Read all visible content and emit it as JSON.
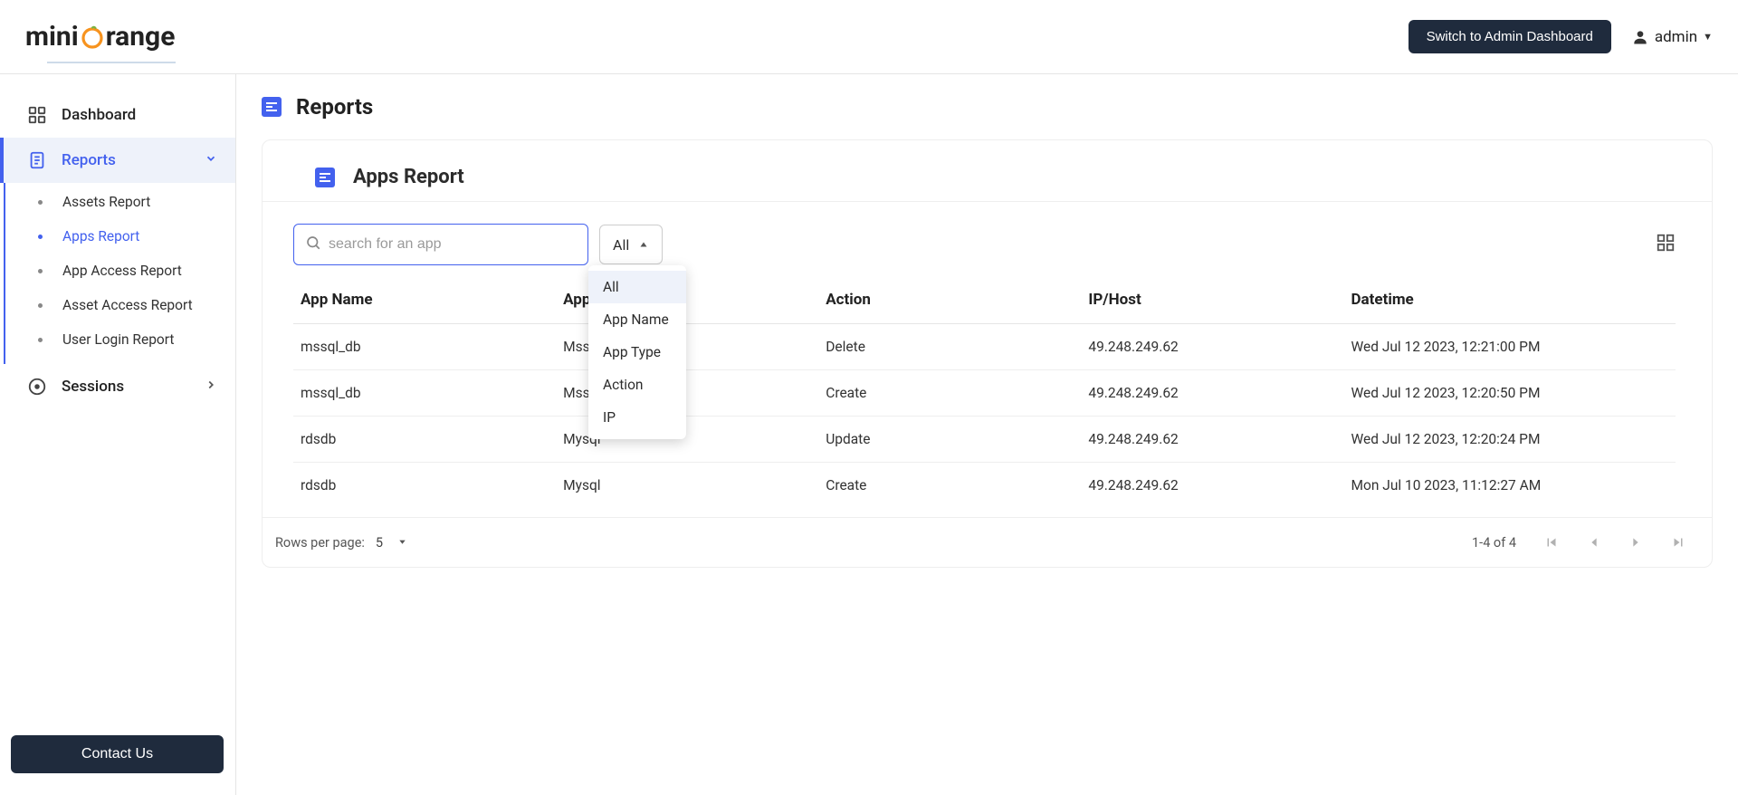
{
  "header": {
    "logo_parts": {
      "pre": "mini",
      "post": "range"
    },
    "switch_btn": "Switch to Admin Dashboard",
    "user_name": "admin"
  },
  "sidebar": {
    "items": [
      {
        "label": "Dashboard"
      },
      {
        "label": "Reports",
        "active": true
      },
      {
        "label": "Sessions"
      }
    ],
    "reports_sub": [
      {
        "label": "Assets Report"
      },
      {
        "label": "Apps Report"
      },
      {
        "label": "App Access Report"
      },
      {
        "label": "Asset Access Report"
      },
      {
        "label": "User Login Report"
      }
    ],
    "contact": "Contact Us"
  },
  "page": {
    "title": "Reports",
    "card_title": "Apps Report"
  },
  "toolbar": {
    "search_placeholder": "search for an app",
    "filter_selected": "All"
  },
  "dropdown": {
    "options": [
      {
        "label": "All"
      },
      {
        "label": "App Name"
      },
      {
        "label": "App Type"
      },
      {
        "label": "Action"
      },
      {
        "label": "IP"
      }
    ]
  },
  "table": {
    "headers": [
      "App Name",
      "App Type",
      "Action",
      "IP/Host",
      "Datetime"
    ],
    "rows": [
      {
        "app_name": "mssql_db",
        "app_type": "Mssql",
        "action": "Delete",
        "ip": "49.248.249.62",
        "dt": "Wed Jul 12 2023, 12:21:00 PM"
      },
      {
        "app_name": "mssql_db",
        "app_type": "Mssql",
        "action": "Create",
        "ip": "49.248.249.62",
        "dt": "Wed Jul 12 2023, 12:20:50 PM"
      },
      {
        "app_name": "rdsdb",
        "app_type": "Mysql",
        "action": "Update",
        "ip": "49.248.249.62",
        "dt": "Wed Jul 12 2023, 12:20:24 PM"
      },
      {
        "app_name": "rdsdb",
        "app_type": "Mysql",
        "action": "Create",
        "ip": "49.248.249.62",
        "dt": "Mon Jul 10 2023, 11:12:27 AM"
      }
    ]
  },
  "footer": {
    "rows_label": "Rows per page:",
    "rows_value": "5",
    "range": "1-4 of 4"
  }
}
